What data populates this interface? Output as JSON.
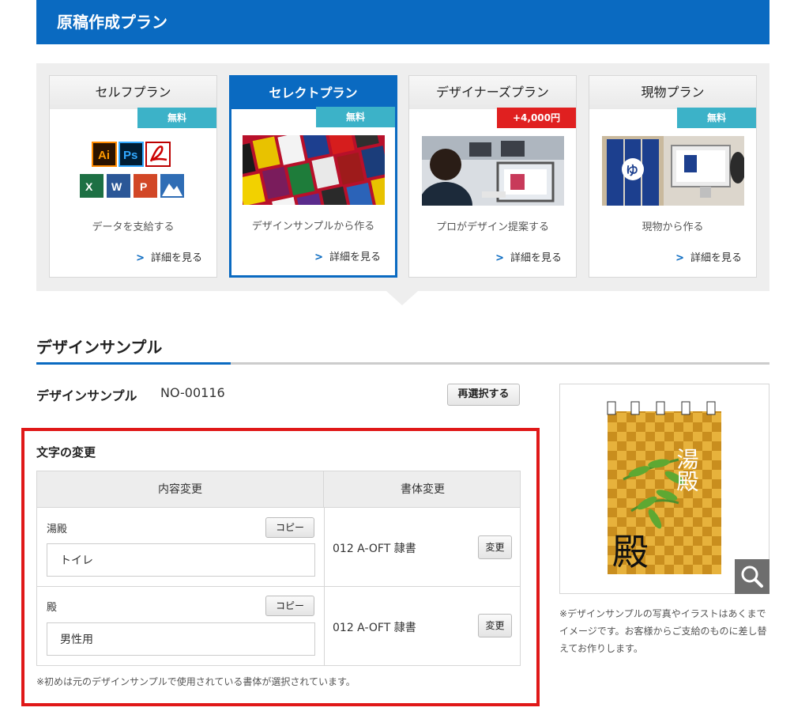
{
  "header": {
    "title": "原稿作成プラン"
  },
  "plans": [
    {
      "title": "セルフプラン",
      "badge": "無料",
      "desc": "データを支給する",
      "link": "詳細を見る"
    },
    {
      "title": "セレクトプラン",
      "badge": "無料",
      "desc": "デザインサンプルから作る",
      "link": "詳細を見る"
    },
    {
      "title": "デザイナーズプラン",
      "badge": "+4,000円",
      "desc": "プロがデザイン提案する",
      "link": "詳細を見る"
    },
    {
      "title": "現物プラン",
      "badge": "無料",
      "desc": "現物から作る",
      "link": "詳細を見る"
    }
  ],
  "section": {
    "title": "デザインサンプル"
  },
  "sample": {
    "label": "デザインサンプル",
    "number": "NO-00116",
    "reselect": "再選択する"
  },
  "text_change": {
    "title": "文字の変更",
    "col_content": "内容変更",
    "col_font": "書体変更",
    "rows": [
      {
        "label": "湯殿",
        "copy": "コピー",
        "value": "トイレ",
        "font": "012 A-OFT 隷書",
        "change": "変更"
      },
      {
        "label": "殿",
        "copy": "コピー",
        "value": "男性用",
        "font": "012 A-OFT 隷書",
        "change": "変更"
      }
    ],
    "note": "※初めは元のデザインサンプルで使用されている書体が選択されています。"
  },
  "preview": {
    "text_top": "湯殿",
    "text_big": "殿",
    "note": "※デザインサンプルの写真やイラストはあくまでイメージです。お客様からご支給のものに差し替えてお作りします。"
  },
  "icons": {
    "app_labels": [
      "Ai",
      "Ps",
      "X",
      "W",
      "P"
    ]
  },
  "colors": {
    "brand": "#0a6ac1",
    "badge_free": "#3cb2c8",
    "badge_paid": "#e02020",
    "highlight": "#e01818"
  }
}
